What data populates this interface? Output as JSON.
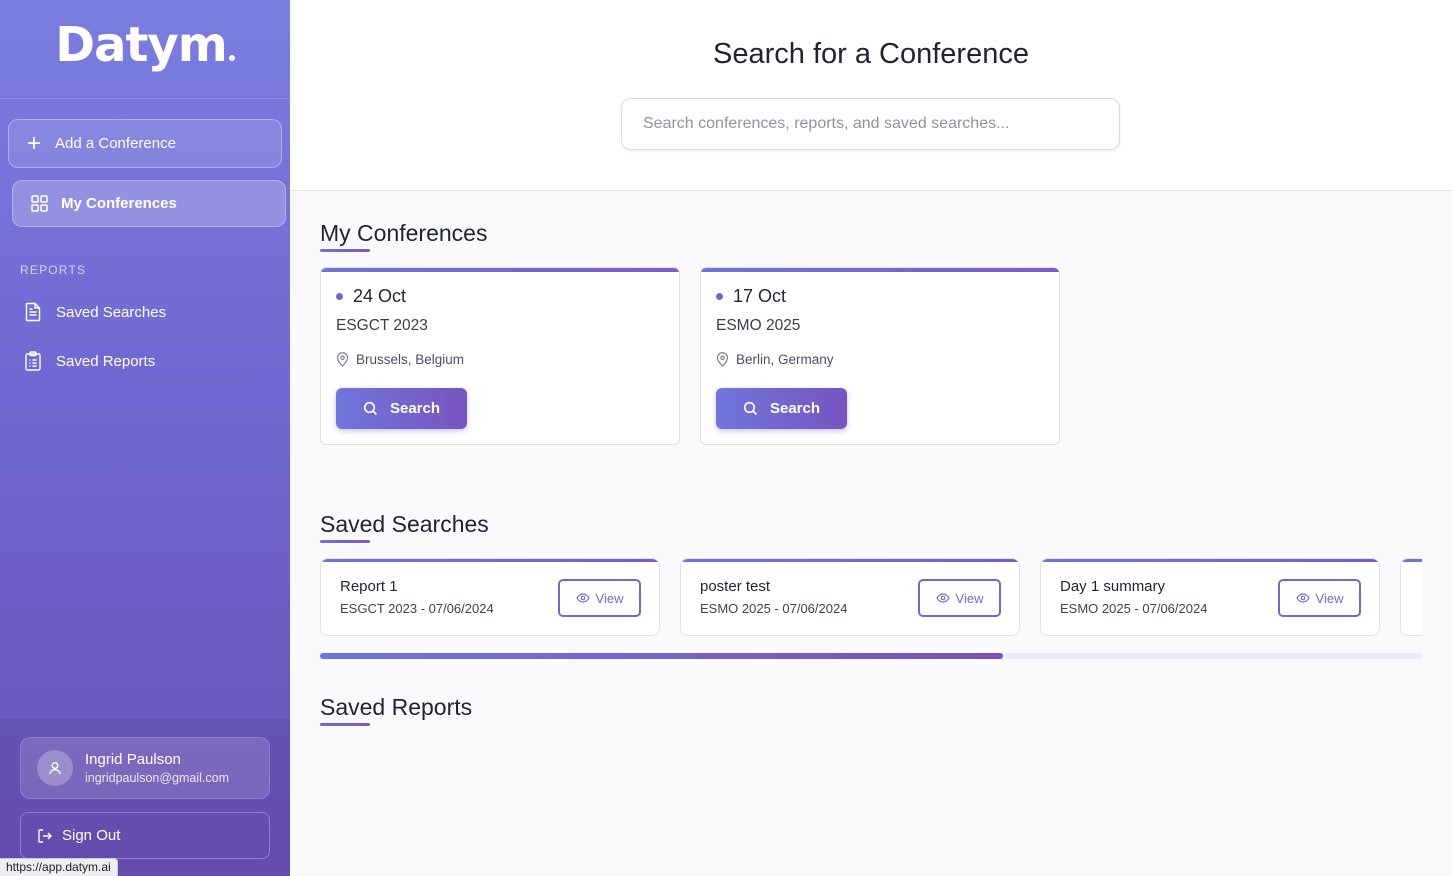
{
  "brand": {
    "logo_text": "Datym"
  },
  "sidebar": {
    "add_button": "Add a Conference",
    "active_item": "My Conferences",
    "section_label": "REPORTS",
    "items": [
      {
        "label": "Saved Searches",
        "icon": "document-icon"
      },
      {
        "label": "Saved Reports",
        "icon": "clipboard-icon"
      }
    ],
    "user": {
      "name": "Ingrid Paulson",
      "email": "ingridpaulson@gmail.com"
    },
    "sign_out": "Sign Out"
  },
  "status_bar": {
    "url": "https://app.datym.ai"
  },
  "header": {
    "title": "Search for a Conference",
    "search_placeholder": "Search conferences, reports, and saved searches..."
  },
  "my_conferences": {
    "title": "My Conferences",
    "cards": [
      {
        "date": "24 Oct",
        "name": "ESGCT 2023",
        "location": "Brussels, Belgium",
        "button": "Search"
      },
      {
        "date": "17 Oct",
        "name": "ESMO 2025",
        "location": "Berlin, Germany",
        "button": "Search"
      }
    ]
  },
  "saved_searches": {
    "title": "Saved Searches",
    "cards": [
      {
        "name": "Report 1",
        "meta": "ESGCT 2023 - 07/06/2024",
        "button": "View"
      },
      {
        "name": "poster test",
        "meta": "ESMO 2025 - 07/06/2024",
        "button": "View"
      },
      {
        "name": "Day 1 summary",
        "meta": "ESMO 2025 - 07/06/2024",
        "button": "View"
      },
      {
        "name": "",
        "meta": "",
        "button": ""
      }
    ],
    "scroll_fraction": 0.62
  },
  "saved_reports": {
    "title": "Saved Reports"
  },
  "colors": {
    "accent": "#6b6bd0",
    "sidebar_top": "#7a7de0",
    "sidebar_bottom": "#6a52b4"
  }
}
